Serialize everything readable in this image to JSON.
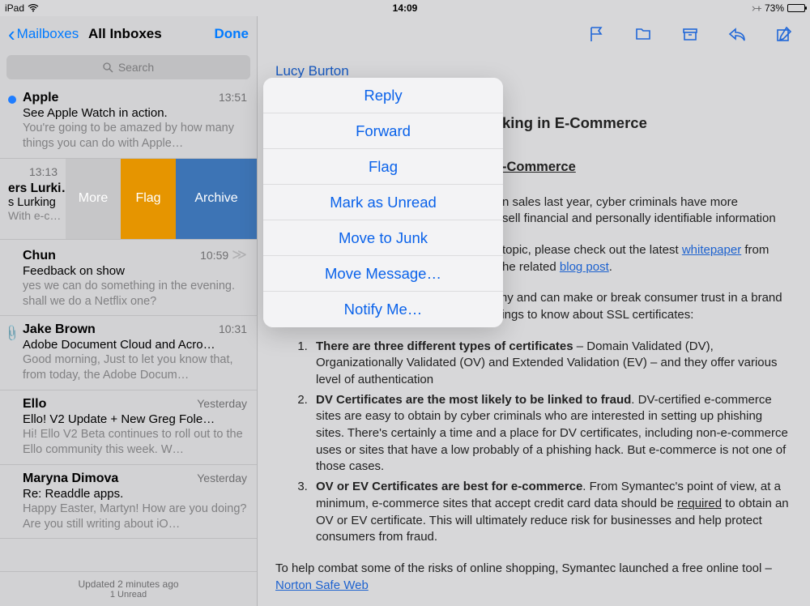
{
  "statusbar": {
    "device": "iPad",
    "time": "14:09",
    "battery_pct": "73%"
  },
  "sidebar": {
    "back": "Mailboxes",
    "title": "All Inboxes",
    "done": "Done",
    "search_placeholder": "Search",
    "footer_line1": "Updated 2 minutes ago",
    "footer_line2": "1 Unread",
    "swipe": {
      "more": "More",
      "flag": "Flag",
      "archive": "Archive"
    },
    "messages": [
      {
        "sender": "Apple",
        "time": "13:51",
        "subject": "See Apple Watch in action.",
        "preview": "You're going to be amazed by how many things you can do with Apple…",
        "unread": true
      },
      {
        "sender_trunc": "ers Lurki…",
        "time": "13:13",
        "subject_trunc": "s Lurking",
        "preview_trunc": "With e-c…"
      },
      {
        "sender": "Chun",
        "time": "10:59",
        "subject": "Feedback on show",
        "preview": "yes we can do something in the evening. shall we do a Netflix one?",
        "thread": true
      },
      {
        "sender": "Jake Brown",
        "time": "10:31",
        "subject": "Adobe Document Cloud and Acro…",
        "preview": "Good morning, Just to let you know that, from today, the Adobe Docum…",
        "attachment": true
      },
      {
        "sender": "Ello",
        "time": "Yesterday",
        "subject": "Ello! V2 Update + New Greg Fole…",
        "preview": "Hi! Ello V2 Beta continues to roll out to the Ello community this week. W…"
      },
      {
        "sender": "Maryna Dimova",
        "time": "Yesterday",
        "subject": "Re: Readdle apps.",
        "preview": "Happy Easter, Martyn! How are you doing? Are you still writing about iO…"
      }
    ]
  },
  "popover": {
    "items": [
      "Reply",
      "Forward",
      "Flag",
      "Mark as Unread",
      "Move to Junk",
      "Move Message…",
      "Notify Me…"
    ]
  },
  "email": {
    "from": "Lucy Burton",
    "title_visible": "king in E-Commerce",
    "heading_visible": "-Commerce",
    "p1_frag": "n sales last year, cyber criminals have more ",
    "p1_frag2": "sell financial and personally identifiable information ",
    "p2_pre": " topic, please check out the latest ",
    "p2_link1": "whitepaper",
    "p2_mid": " from ",
    "p2_end": "he related ",
    "p2_link2": "blog post",
    "p3": "SSL certificates power the Internet economy and can make or break consumer trust in a brand or business. Following are the top three things to know about SSL certificates:",
    "list": [
      {
        "bold": "There are three different types of certificates",
        "rest": " – Domain Validated (DV), Organizationally Validated (OV) and Extended Validation (EV) – and they offer various level of authentication"
      },
      {
        "bold": "DV Certificates are the most likely to be linked to fraud",
        "rest": ". DV-certified e-commerce sites are easy to obtain by cyber criminals who are interested in setting up phishing sites. There's certainly a time and a place for DV certificates, including non-e-commerce uses or sites that have a low probably of a phishing hack. But e-commerce is not one of those cases."
      },
      {
        "bold": "OV or EV Certificates are best for e-commerce",
        "rest_a": ". From Symantec's point of view, at a minimum, e-commerce sites that accept credit card data should be ",
        "underlined": "required",
        "rest_b": " to obtain an OV or EV certificate. This will ultimately reduce risk for businesses and help protect consumers from fraud."
      }
    ],
    "p4_pre": "To help combat some of the risks of online shopping, Symantec launched a free online tool – ",
    "p4_link": "Norton Safe Web"
  }
}
